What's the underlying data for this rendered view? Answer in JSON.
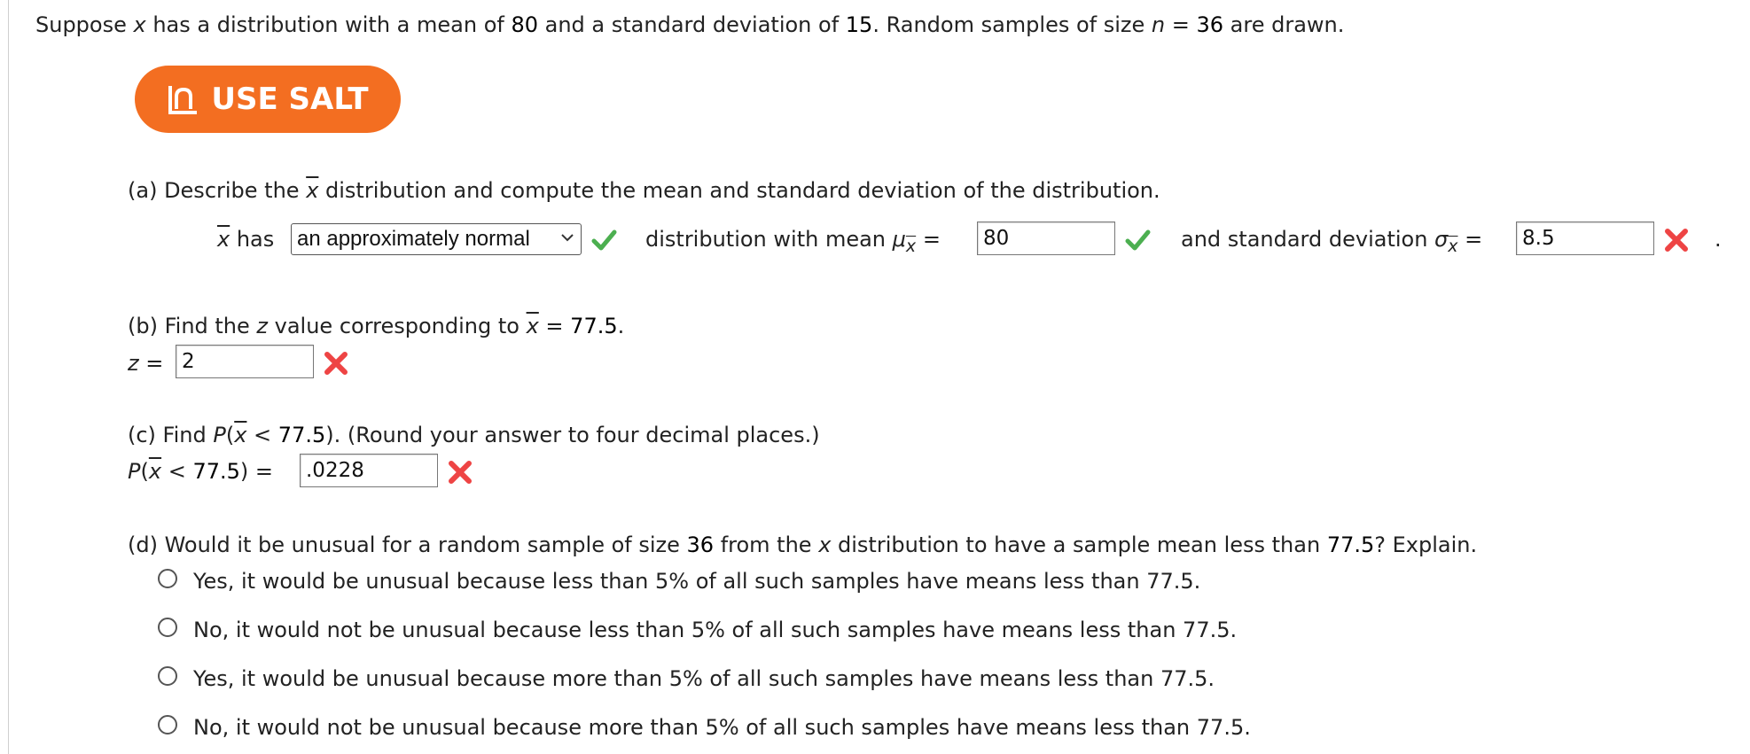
{
  "intro": {
    "t1": "Suppose ",
    "var_x": "x",
    "t2": " has a distribution with a mean of ",
    "mean": "80",
    "t3": " and a standard deviation of ",
    "sd": "15",
    "t4": ". Random samples of size ",
    "var_n": "n",
    "t5": " = ",
    "n": "36",
    "t6": " are drawn."
  },
  "salt_button": {
    "label": "USE SALT",
    "color": "#f36e21",
    "icon": "salt-chart-icon"
  },
  "part_a": {
    "prompt_1": "(a) Describe the ",
    "xbar": "x",
    "prompt_2": " distribution and compute the mean and standard deviation of the distribution.",
    "row_xbar": "x",
    "row_has": " has",
    "dist_select_value": "an approximately normal",
    "dist_status": "correct",
    "mid_text": "distribution with mean ",
    "mu": "μ",
    "sub_x": "x",
    "eq": "=",
    "mean_value": "80",
    "mean_status": "correct",
    "sd_text": "and standard deviation ",
    "sigma": "σ",
    "sd_value": "8.5",
    "sd_status": "incorrect",
    "end_dot": "."
  },
  "part_b": {
    "prompt_1": "(b) Find the ",
    "z": "z",
    "prompt_2": " value corresponding to ",
    "xbar": "x",
    "prompt_3": " = ",
    "value": "77.5",
    "prompt_4": ".",
    "z_label": "z",
    "eq": "=",
    "answer": "2",
    "answer_status": "incorrect"
  },
  "part_c": {
    "prompt_1": "(c) Find ",
    "P": "P",
    "open": "(",
    "xbar": "x",
    "rel": " < ",
    "value": "77.5",
    "close": "). (Round your answer to four decimal places.)",
    "row_lhs_close": ") =",
    "answer": ".0228",
    "answer_status": "incorrect"
  },
  "part_d": {
    "prompt_1": "(d) Would it be unusual for a random sample of size ",
    "n": "36",
    "prompt_2": " from the ",
    "x": "x",
    "prompt_3": " distribution to have a sample mean less than ",
    "value": "77.5",
    "prompt_4": "? Explain.",
    "options": [
      "Yes, it would be unusual because less than 5% of all such samples have means less than 77.5.",
      "No, it would not be unusual because less than 5% of all such samples have means less than 77.5.",
      "Yes, it would be unusual because more than 5% of all such samples have means less than 77.5.",
      "No, it would not be unusual because more than 5% of all such samples have means less than 77.5."
    ]
  },
  "colors": {
    "correct": "#4caf50",
    "incorrect": "#ee4444",
    "accent": "#f36e21"
  }
}
